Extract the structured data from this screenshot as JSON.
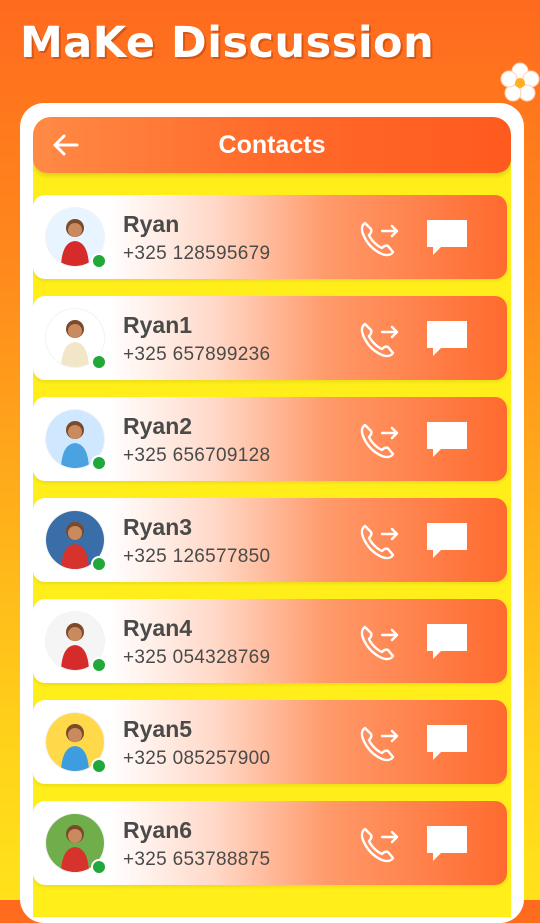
{
  "promo": {
    "title": "MaKe Discussion"
  },
  "header": {
    "title": "Contacts",
    "back_icon": "arrow-left-icon"
  },
  "contacts": [
    {
      "name": "Ryan",
      "phone": "+325 128595679"
    },
    {
      "name": "Ryan1",
      "phone": "+325 657899236"
    },
    {
      "name": "Ryan2",
      "phone": "+325 656709128"
    },
    {
      "name": "Ryan3",
      "phone": "+325 126577850"
    },
    {
      "name": "Ryan4",
      "phone": "+325 054328769"
    },
    {
      "name": "Ryan5",
      "phone": "+325 085257900"
    },
    {
      "name": "Ryan6",
      "phone": "+325 653788875"
    }
  ],
  "icons": {
    "call": "phone-forward-icon",
    "message": "chat-bubble-icon",
    "status": "online-status-dot"
  },
  "colors": {
    "accent": "#ff6a2a",
    "background_top": "#ff6a1e",
    "background_bottom": "#ffe21a",
    "screen": "#ffee1a",
    "online": "#22a83a",
    "text": "#4a4a4a"
  }
}
